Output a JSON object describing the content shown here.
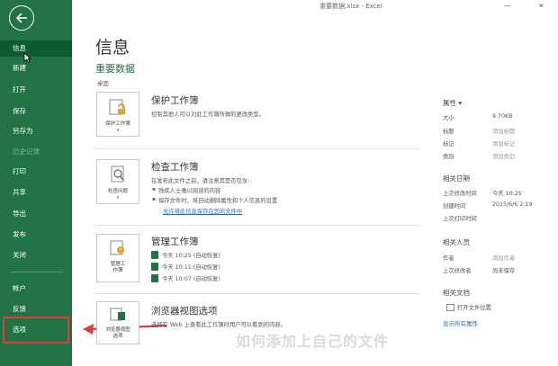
{
  "window": {
    "title": "重要数据.xlsx - Excel",
    "min": "—",
    "close": "✕"
  },
  "sidebar": {
    "items": [
      {
        "label": "信息",
        "active": true
      },
      {
        "label": "新建"
      },
      {
        "label": "打开"
      },
      {
        "label": "保存"
      },
      {
        "label": "另存为"
      },
      {
        "label": "历史记录",
        "disabled": true
      },
      {
        "label": "打印"
      },
      {
        "label": "共享"
      },
      {
        "label": "导出"
      },
      {
        "label": "发布"
      },
      {
        "label": "关闭"
      },
      {
        "label": "帐户"
      },
      {
        "label": "反馈"
      },
      {
        "label": "选项"
      }
    ]
  },
  "main": {
    "title": "信息",
    "doc_name": "重要数据",
    "doc_path": "桌面",
    "protect": {
      "tile": "保护工作簿",
      "title": "保护工作簿",
      "desc": "控制其他人可以对此工作簿所做的更改类型。"
    },
    "inspect": {
      "tile": "检查问题",
      "title": "检查工作簿",
      "desc": "在发布此文件之前，请注意其是否包含:",
      "bullets": [
        "残疾人士难以阅读的内容",
        "保存文件时，将自动删除属性和个人信息的设置"
      ],
      "link": "允许将此信息保存在您的文件中"
    },
    "manage": {
      "tile_line1": "管理工",
      "tile_line2": "作簿",
      "title": "管理工作簿",
      "versions": [
        "今天 10:25 (自动恢复)",
        "今天 10:11 (自动恢复)",
        "今天 10:07 (自动恢复)"
      ]
    },
    "browser": {
      "tile_line1": "浏览器视图",
      "tile_line2": "选项",
      "title": "浏览器视图选项",
      "desc": "选择在 Web 上查看此工作簿时用户可以看到的内容。"
    }
  },
  "properties": {
    "title": "属性",
    "rows": [
      {
        "label": "大小",
        "value": "9.70KB"
      },
      {
        "label": "标题",
        "value": "添加标题"
      },
      {
        "label": "标记",
        "value": "添加标记"
      },
      {
        "label": "类别",
        "value": "添加类别"
      }
    ],
    "dates_title": "相关日期",
    "dates": [
      {
        "label": "上次修改时间",
        "value": "今天 10:25"
      },
      {
        "label": "创建时间",
        "value": "2015/6/6 2:19"
      },
      {
        "label": "上次打印时间",
        "value": ""
      }
    ],
    "people_title": "相关人员",
    "people": [
      {
        "label": "作者",
        "value": "添加作者"
      },
      {
        "label": "上次修改者",
        "value": "尚未保存"
      }
    ],
    "docs_title": "相关文档",
    "open_location": "打开文件位置",
    "show_all": "显示所有属性"
  },
  "watermark": "如何添加上自己的文件"
}
